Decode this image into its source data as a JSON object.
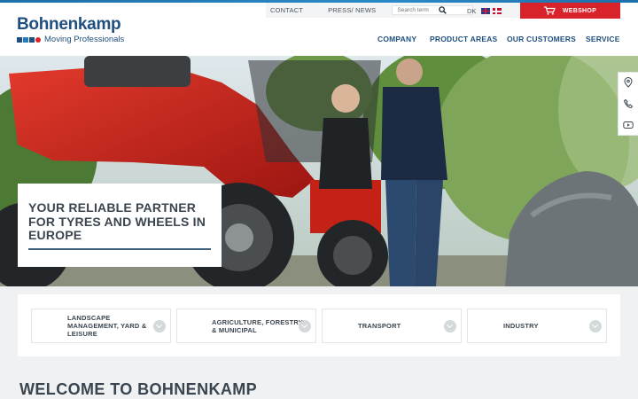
{
  "brand": {
    "name": "Bohnenkamp",
    "tagline": "Moving Professionals",
    "colors": {
      "primary": "#1e4f7e",
      "accent": "#d8232a"
    }
  },
  "utility_nav": {
    "contact": "CONTACT",
    "press": "PRESS/ NEWS",
    "search_placeholder": "Search term",
    "language": "DK",
    "flags": [
      "uk-flag-icon",
      "dk-flag-icon"
    ],
    "webshop": "WEBSHOP"
  },
  "main_nav": {
    "items": [
      "COMPANY",
      "PRODUCT AREAS",
      "OUR CUSTOMERS",
      "SERVICE"
    ]
  },
  "hero": {
    "headline": "YOUR RELIABLE PARTNER FOR TYRES AND WHEELS IN EUROPE"
  },
  "side_tools": [
    "location-pin-icon",
    "phone-icon",
    "youtube-icon"
  ],
  "slider_controls": [
    "arrow-left-icon",
    "arrow-right-icon"
  ],
  "categories": [
    {
      "label": "LANDSCAPE MANAGEMENT, YARD & LEISURE"
    },
    {
      "label": "AGRICULTURE, FORESTRY & MUNICIPAL"
    },
    {
      "label": "TRANSPORT"
    },
    {
      "label": "INDUSTRY"
    }
  ],
  "welcome": {
    "heading": "WELCOME TO BOHNENKAMP"
  }
}
